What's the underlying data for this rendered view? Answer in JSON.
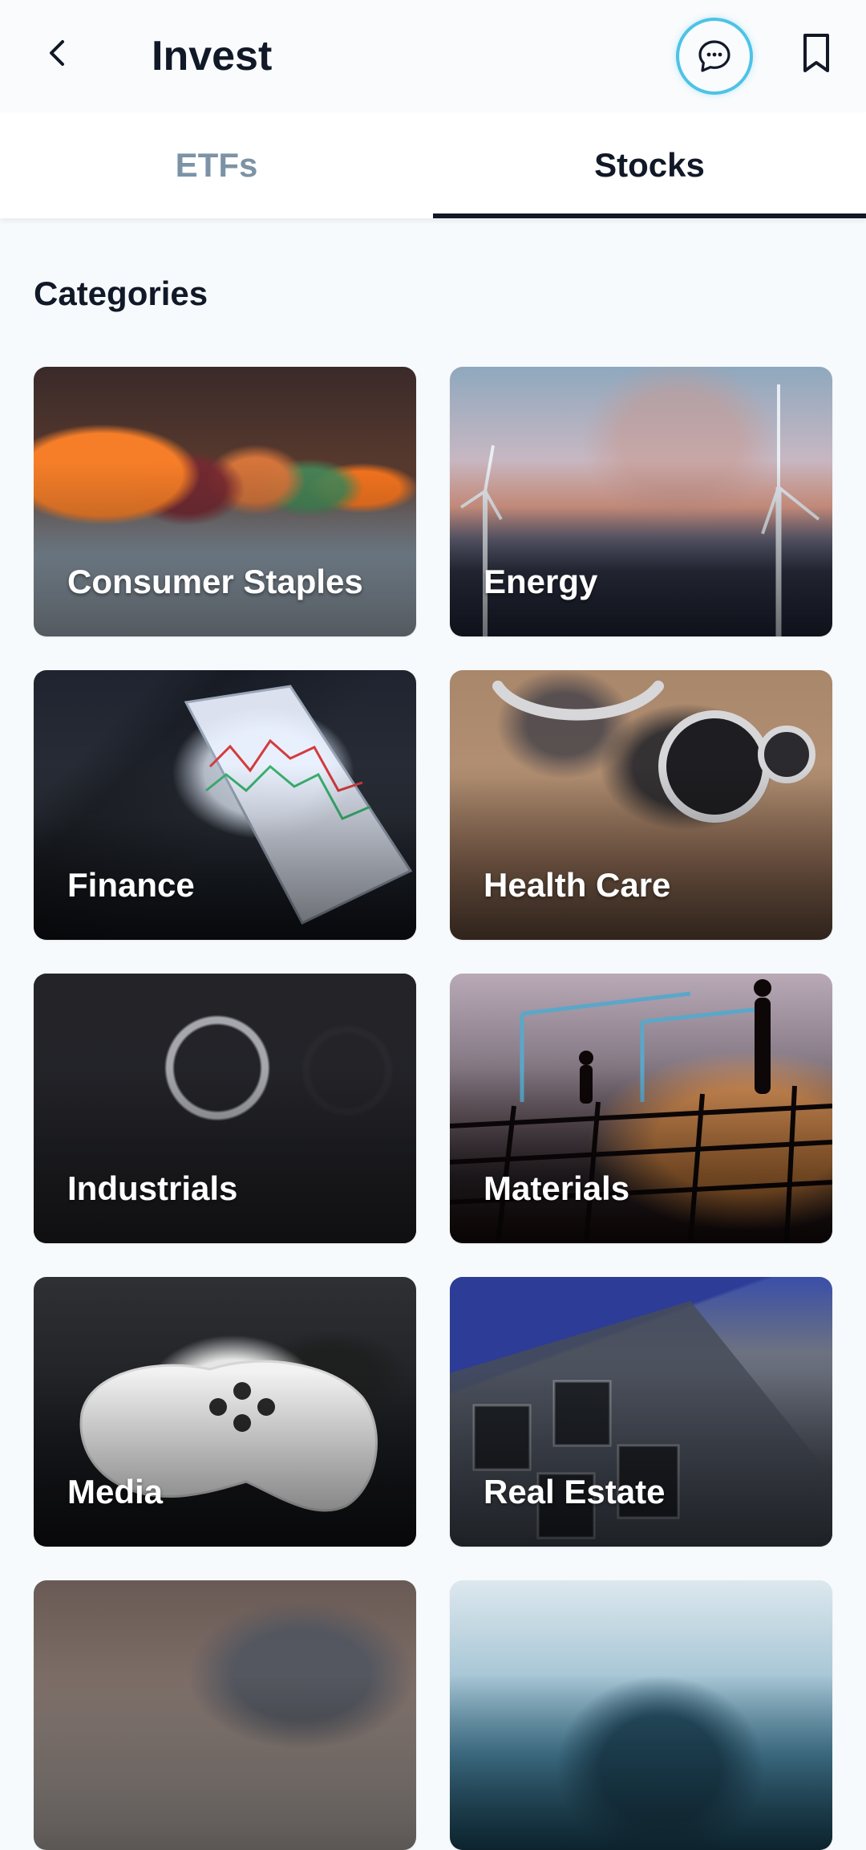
{
  "header": {
    "title": "Invest",
    "icons": {
      "back": "chevron-left-icon",
      "chat": "chat-bubble-icon",
      "bookmark": "bookmark-icon"
    },
    "colors": {
      "chat_ring": "#4CC3E6",
      "title_text": "#111827"
    }
  },
  "tabs": [
    {
      "label": "ETFs",
      "active": false
    },
    {
      "label": "Stocks",
      "active": true
    }
  ],
  "section": {
    "title": "Categories"
  },
  "categories": [
    {
      "label": "Consumer Staples"
    },
    {
      "label": "Energy"
    },
    {
      "label": "Finance"
    },
    {
      "label": "Health Care"
    },
    {
      "label": "Industrials"
    },
    {
      "label": "Materials"
    },
    {
      "label": "Media"
    },
    {
      "label": "Real Estate"
    }
  ],
  "colors": {
    "page_bg": "#F7FAFC",
    "tab_inactive": "#7C93A6",
    "tab_active": "#111827",
    "tab_indicator": "#111827"
  }
}
